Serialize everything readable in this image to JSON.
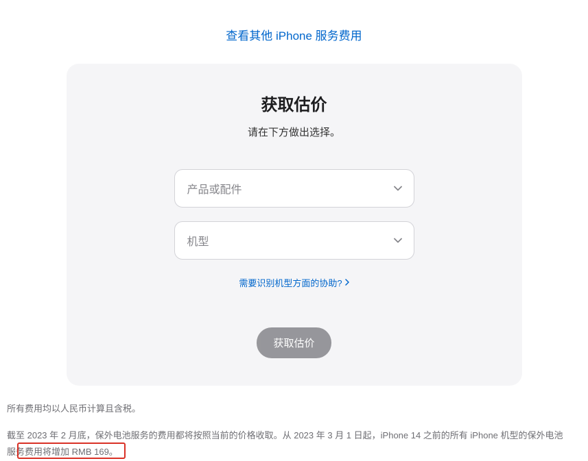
{
  "topLink": "查看其他 iPhone 服务费用",
  "card": {
    "title": "获取估价",
    "subtitle": "请在下方做出选择。",
    "select1": "产品或配件",
    "select2": "机型",
    "helpLink": "需要识别机型方面的协助?",
    "button": "获取估价"
  },
  "footnote1": "所有费用均以人民币计算且含税。",
  "footnote2": "截至 2023 年 2 月底，保外电池服务的费用都将按照当前的价格收取。从 2023 年 3 月 1 日起，iPhone 14 之前的所有 iPhone 机型的保外电池服务费用将增加 RMB 169。"
}
